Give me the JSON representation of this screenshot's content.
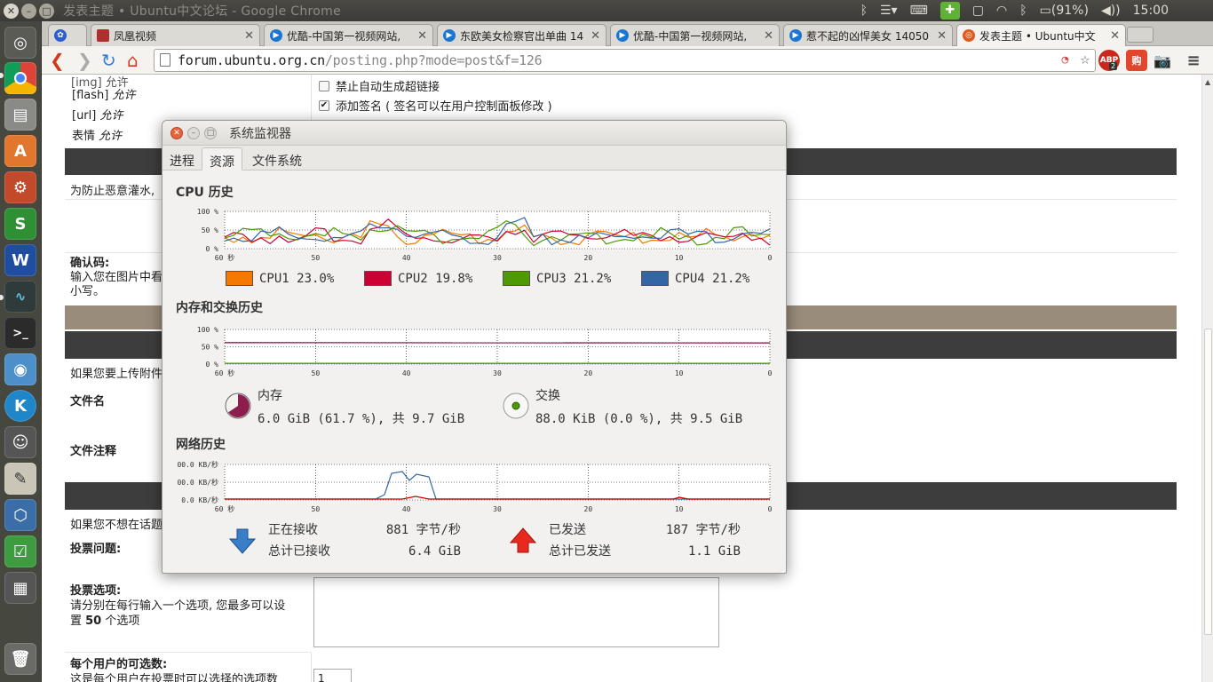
{
  "window": {
    "title": "发表主题 • Ubuntu中文论坛 - Google Chrome"
  },
  "tray": {
    "battery": "(91%)",
    "time": "15:00"
  },
  "tabs": [
    {
      "label": "凤凰视频",
      "favcolor": "#b03030"
    },
    {
      "label": "优酷-中国第一视频网站,",
      "favcolor": "#1976d2"
    },
    {
      "label": "东欧美女检察官出单曲 14",
      "favcolor": "#1976d2"
    },
    {
      "label": "优酷-中国第一视频网站,",
      "favcolor": "#1976d2"
    },
    {
      "label": "惹不起的凶悍美女 14050",
      "favcolor": "#1976d2"
    },
    {
      "label": "发表主题 • Ubuntu中文",
      "favcolor": "#e05a1e"
    }
  ],
  "url": {
    "host": "forum.ubuntu.org.cn",
    "path": "/posting.php?mode=post&f=126"
  },
  "extensions": {
    "abp_label": "ABP",
    "abp_badge": "2",
    "buy_label": "购"
  },
  "form": {
    "flash": "[flash]",
    "flash_status": "允许",
    "url": "[url]",
    "url_status": "允许",
    "emoticons": "表情",
    "emoticons_status": "允许",
    "opt_disable_links": "禁止自动生成超链接",
    "opt_add_signature": "添加签名 ( 签名可以在用户控制面板修改 )",
    "antispam_note": "为防止恶意灌水,",
    "captcha_title": "确认码:",
    "captcha_desc1": "输入您在图片中看",
    "captcha_desc2": "小写。",
    "attach_note": "如果您要上传附件",
    "filename_label": "文件名",
    "file_comment_label": "文件注释",
    "poll_note": "如果您不想在话题",
    "poll_question": "投票问题:",
    "poll_options": "投票选项:",
    "poll_options_desc1": "请分别在每行输入一个选项, 您最多可以设",
    "poll_options_desc2_pre": "置 ",
    "poll_options_max": "50",
    "poll_options_desc2_post": " 个选项",
    "max_choices": "每个用户的可选数:",
    "max_choices_desc": "这是每个用户在投票时可以选择的选项数",
    "max_choices_value": "1"
  },
  "sysmon": {
    "title": "系统监视器",
    "tabs": [
      "进程",
      "资源",
      "文件系统"
    ],
    "cpu_section": "CPU 历史",
    "mem_section": "内存和交换历史",
    "net_section": "网络历史",
    "x_ticks": [
      "60 秒",
      "50",
      "40",
      "30",
      "20",
      "10",
      "0"
    ],
    "cpu_yticks": [
      "100 %",
      "50 %",
      "0 %"
    ],
    "mem_yticks": [
      "100 %",
      "50 %",
      "0 %"
    ],
    "net_yticks": [
      "00.0 KB/秒",
      "00.0 KB/秒",
      "0.0 KB/秒"
    ],
    "cpus": [
      {
        "label": "CPU1 23.0%",
        "color": "#f57900"
      },
      {
        "label": "CPU2 19.8%",
        "color": "#cc0033"
      },
      {
        "label": "CPU3 21.2%",
        "color": "#4e9a06"
      },
      {
        "label": "CPU4 21.2%",
        "color": "#3465a4"
      }
    ],
    "memory": {
      "label": "内存",
      "value": "6.0 GiB (61.7 %), 共 9.7 GiB",
      "color": "#8c1d4d"
    },
    "swap": {
      "label": "交换",
      "value": "88.0 KiB (0.0 %), 共 9.5 GiB",
      "color": "#4e9a06"
    },
    "network": {
      "receiving_label": "正在接收",
      "receiving_value": "881 字节/秒",
      "total_received_label": "总计已接收",
      "total_received_value": "6.4 GiB",
      "sending_label": "已发送",
      "sending_value": "187 字节/秒",
      "total_sent_label": "总计已发送",
      "total_sent_value": "1.1 GiB"
    }
  }
}
